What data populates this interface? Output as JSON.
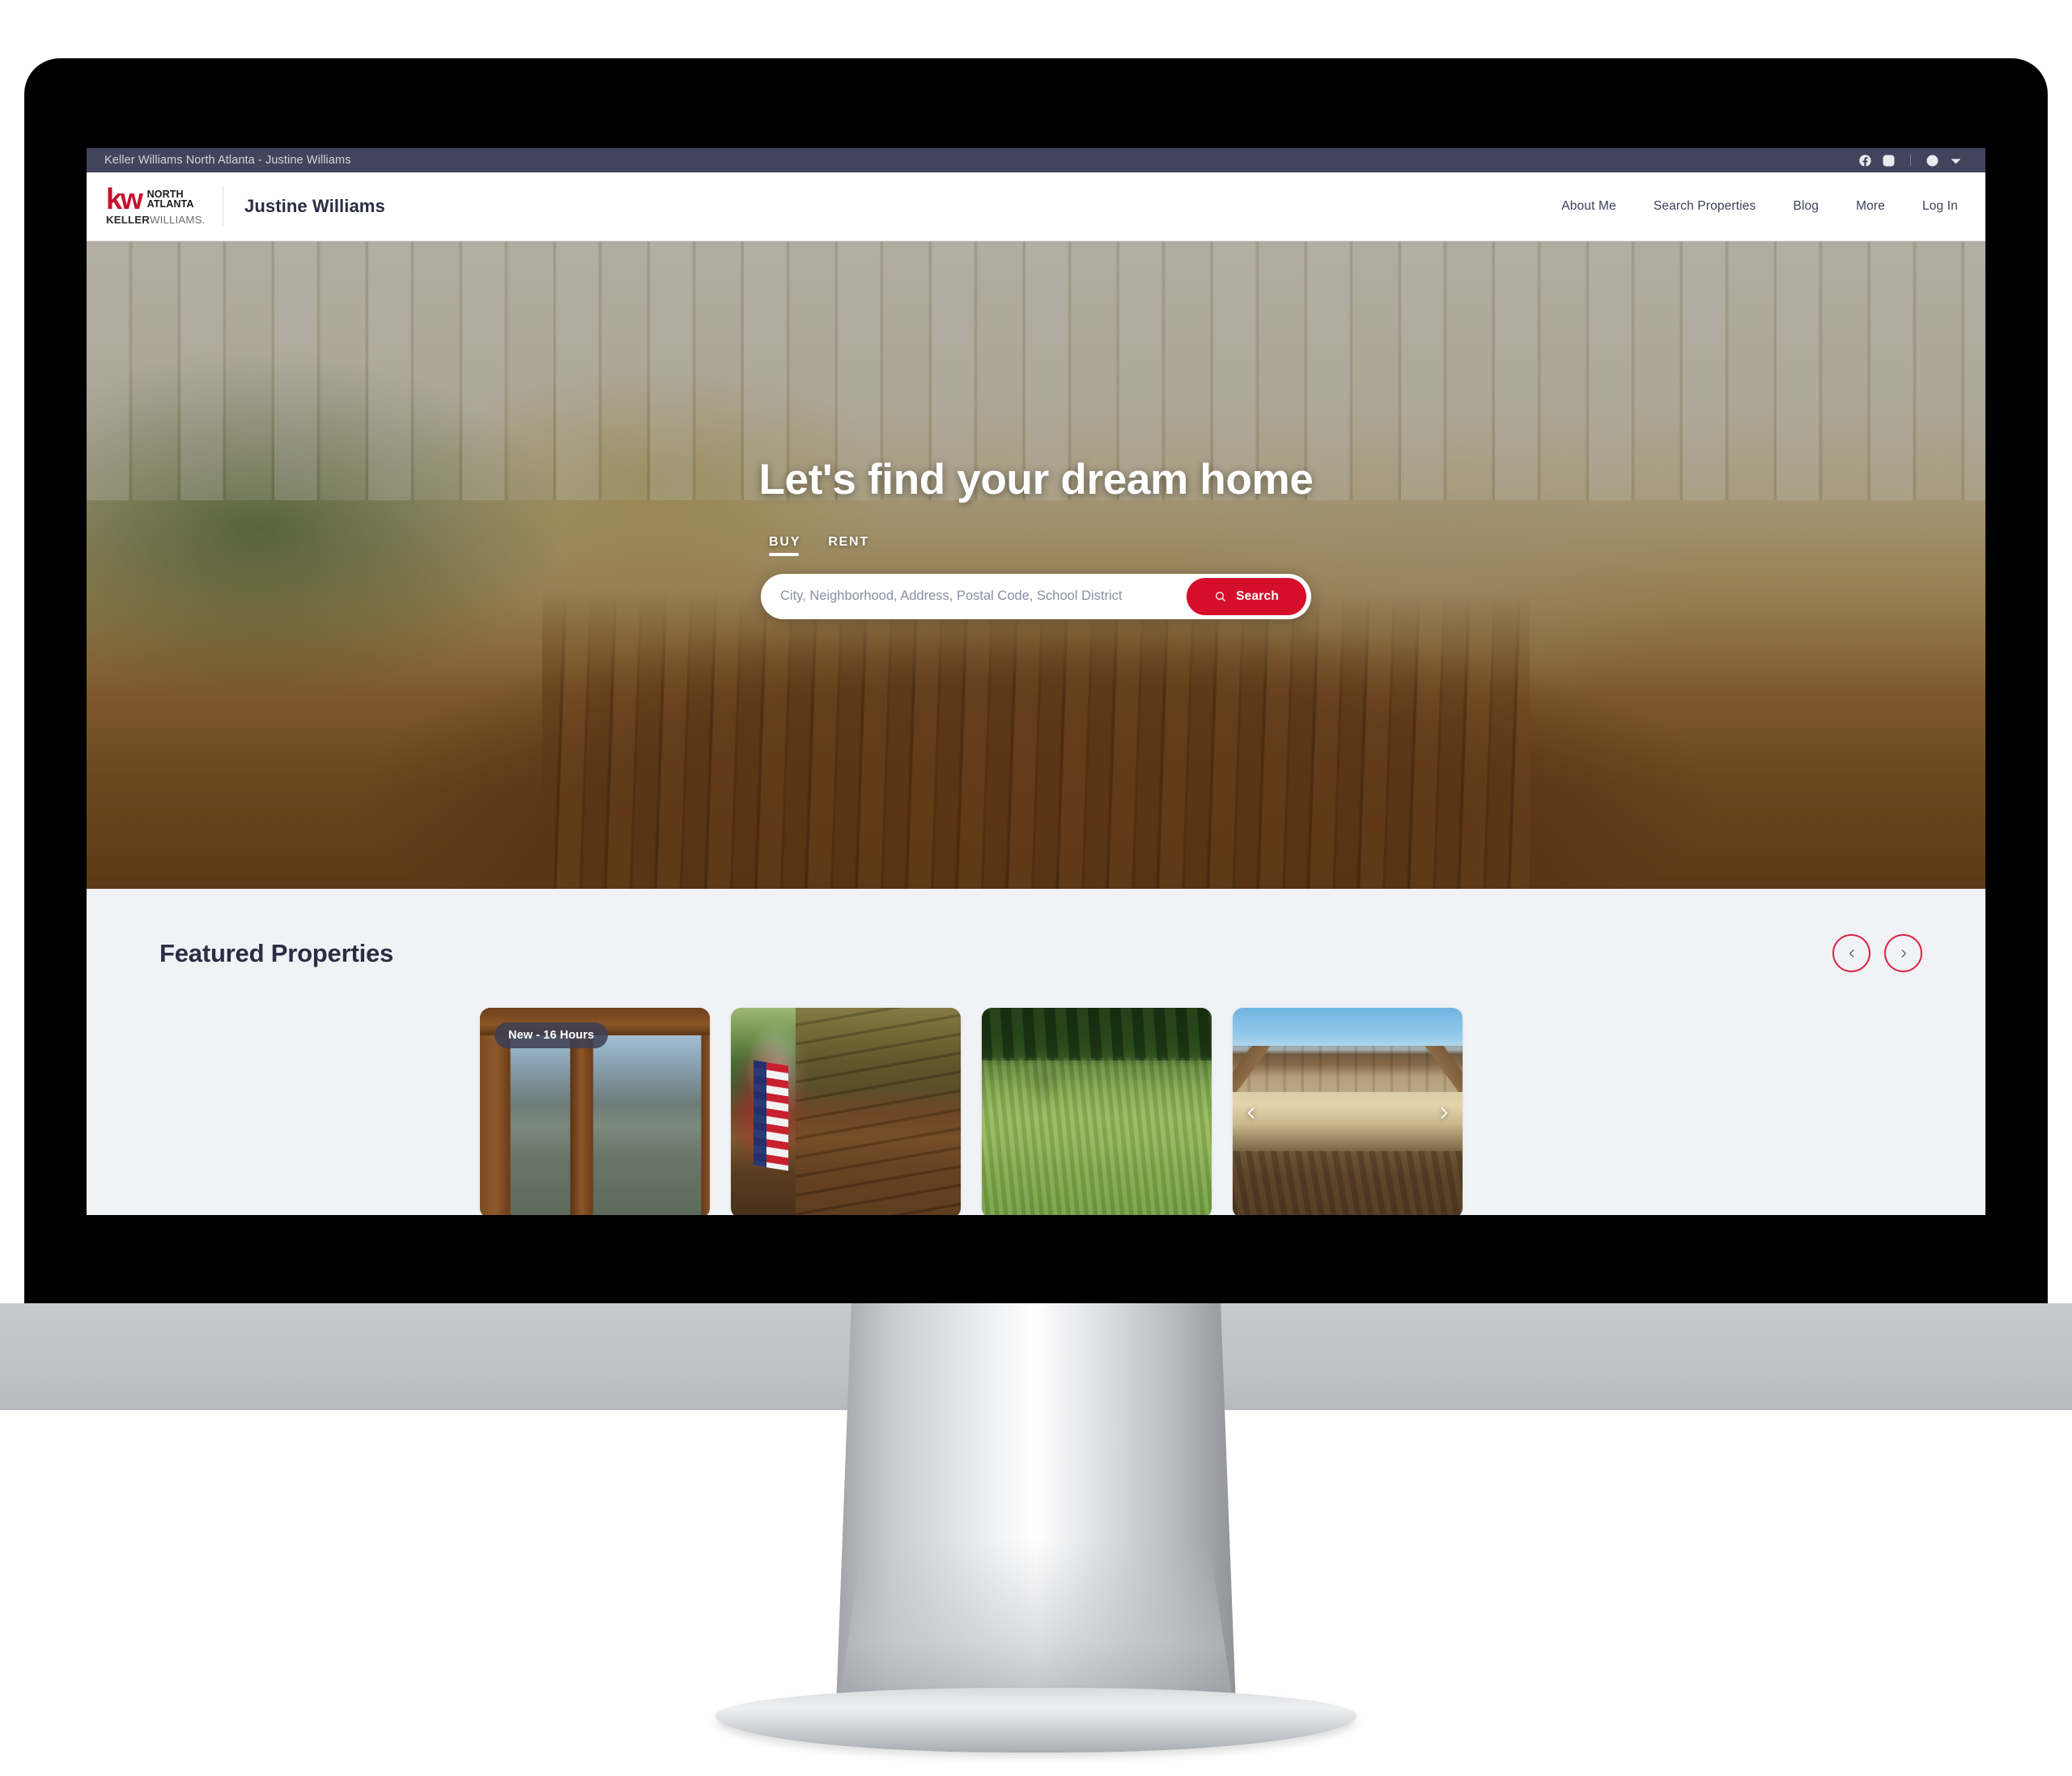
{
  "utility_bar": {
    "title": "Keller Williams North Atlanta - Justine Williams",
    "icons": [
      "facebook-icon",
      "instagram-icon",
      "globe-icon",
      "chevron-down-icon"
    ]
  },
  "header": {
    "logo": {
      "mark": "kw",
      "region_line1": "NORTH",
      "region_line2": "ATLANTA",
      "wordmark_bold": "KELLER",
      "wordmark_light": "WILLIAMS."
    },
    "agent_name": "Justine Williams",
    "nav": [
      {
        "label": "About Me"
      },
      {
        "label": "Search Properties"
      },
      {
        "label": "Blog"
      },
      {
        "label": "More"
      },
      {
        "label": "Log In"
      }
    ]
  },
  "hero": {
    "title": "Let's find your dream home",
    "tabs": [
      {
        "label": "BUY",
        "active": true
      },
      {
        "label": "RENT",
        "active": false
      }
    ],
    "search": {
      "placeholder": "City, Neighborhood, Address, Postal Code, School District",
      "value": "",
      "button_label": "Search",
      "button_icon": "search-icon"
    }
  },
  "featured": {
    "title": "Featured Properties",
    "prev_icon": "chevron-left-icon",
    "next_icon": "chevron-right-icon",
    "cards": [
      {
        "badge": "New - 16 Hours",
        "photo": "cabin-interior-mountain-view",
        "has_arrows": false
      },
      {
        "badge": "",
        "photo": "cabin-exterior-with-american-flag",
        "has_arrows": false
      },
      {
        "badge": "",
        "photo": "open-grass-field-land",
        "has_arrows": false
      },
      {
        "badge": "",
        "photo": "craftsman-house-exterior",
        "has_arrows": true
      }
    ]
  },
  "colors": {
    "brand_red": "#c8102e",
    "button_red": "#d50f2b",
    "utility_bar": "#41445c",
    "navy_text": "#2b2d42",
    "featured_bg": "#f0f2f5"
  }
}
